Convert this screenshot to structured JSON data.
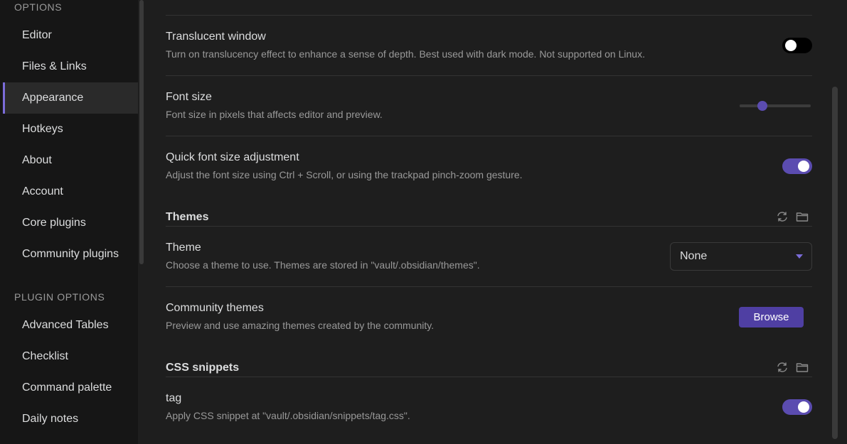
{
  "sidebar": {
    "options_heading": "OPTIONS",
    "items": [
      {
        "label": "Editor"
      },
      {
        "label": "Files & Links"
      },
      {
        "label": "Appearance",
        "active": true
      },
      {
        "label": "Hotkeys"
      },
      {
        "label": "About"
      },
      {
        "label": "Account"
      },
      {
        "label": "Core plugins"
      },
      {
        "label": "Community plugins"
      }
    ],
    "plugin_heading": "PLUGIN OPTIONS",
    "plugin_items": [
      {
        "label": "Advanced Tables"
      },
      {
        "label": "Checklist"
      },
      {
        "label": "Command palette"
      },
      {
        "label": "Daily notes"
      }
    ]
  },
  "settings": {
    "translucent": {
      "name": "Translucent window",
      "desc": "Turn on translucency effect to enhance a sense of depth. Best used with dark mode. Not supported on Linux.",
      "enabled": false
    },
    "font_size": {
      "name": "Font size",
      "desc": "Font size in pixels that affects editor and preview.",
      "slider_fraction": 0.32
    },
    "quick_font": {
      "name": "Quick font size adjustment",
      "desc": "Adjust the font size using Ctrl + Scroll, or using the trackpad pinch-zoom gesture.",
      "enabled": true
    }
  },
  "themes": {
    "heading": "Themes",
    "theme": {
      "name": "Theme",
      "desc": "Choose a theme to use. Themes are stored in \"vault/.obsidian/themes\".",
      "selected": "None"
    },
    "community": {
      "name": "Community themes",
      "desc": "Preview and use amazing themes created by the community.",
      "button": "Browse"
    }
  },
  "snippets": {
    "heading": "CSS snippets",
    "tag": {
      "name": "tag",
      "desc": "Apply CSS snippet at \"vault/.obsidian/snippets/tag.css\".",
      "enabled": true
    }
  },
  "colors": {
    "accent": "#5b4cb0",
    "button": "#4f3fa3"
  },
  "icons": [
    "reload-icon",
    "folder-icon"
  ]
}
